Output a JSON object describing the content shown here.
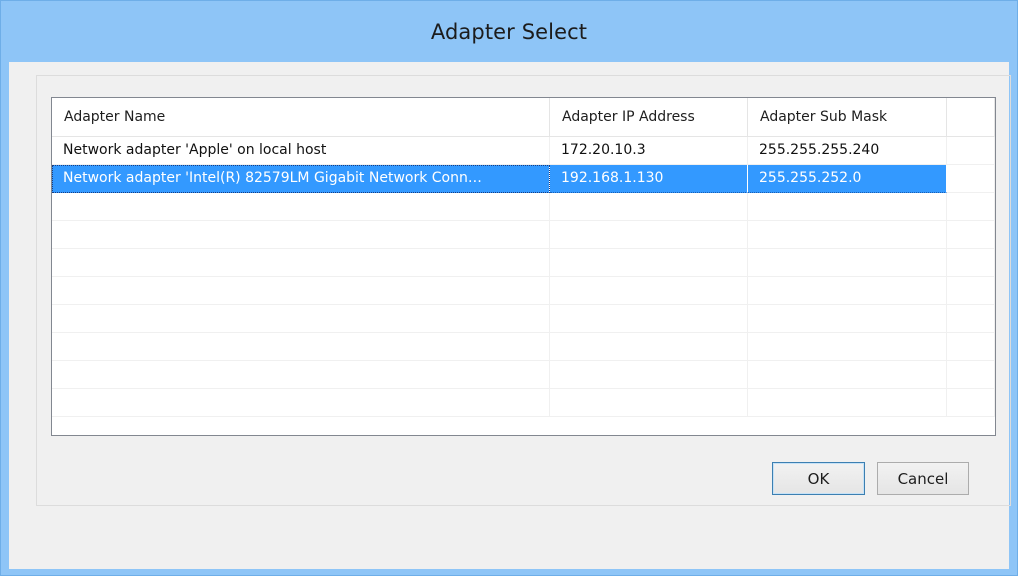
{
  "window": {
    "title": "Adapter Select"
  },
  "grid": {
    "columns": [
      {
        "label": "Adapter Name"
      },
      {
        "label": "Adapter IP Address"
      },
      {
        "label": "Adapter Sub Mask"
      },
      {
        "label": ""
      }
    ],
    "rows": [
      {
        "name": "Network adapter 'Apple' on local host",
        "ip": "172.20.10.3",
        "mask": "255.255.255.240",
        "selected": false
      },
      {
        "name": "Network adapter 'Intel(R) 82579LM Gigabit Network Conn…",
        "ip": "192.168.1.130",
        "mask": "255.255.252.0",
        "selected": true
      }
    ],
    "empty_rows": 8
  },
  "buttons": {
    "ok_label": "OK",
    "cancel_label": "Cancel"
  },
  "colors": {
    "titlebar": "#8ec5f7",
    "selection": "#3399ff",
    "dialog_bg": "#f0f0f0"
  }
}
